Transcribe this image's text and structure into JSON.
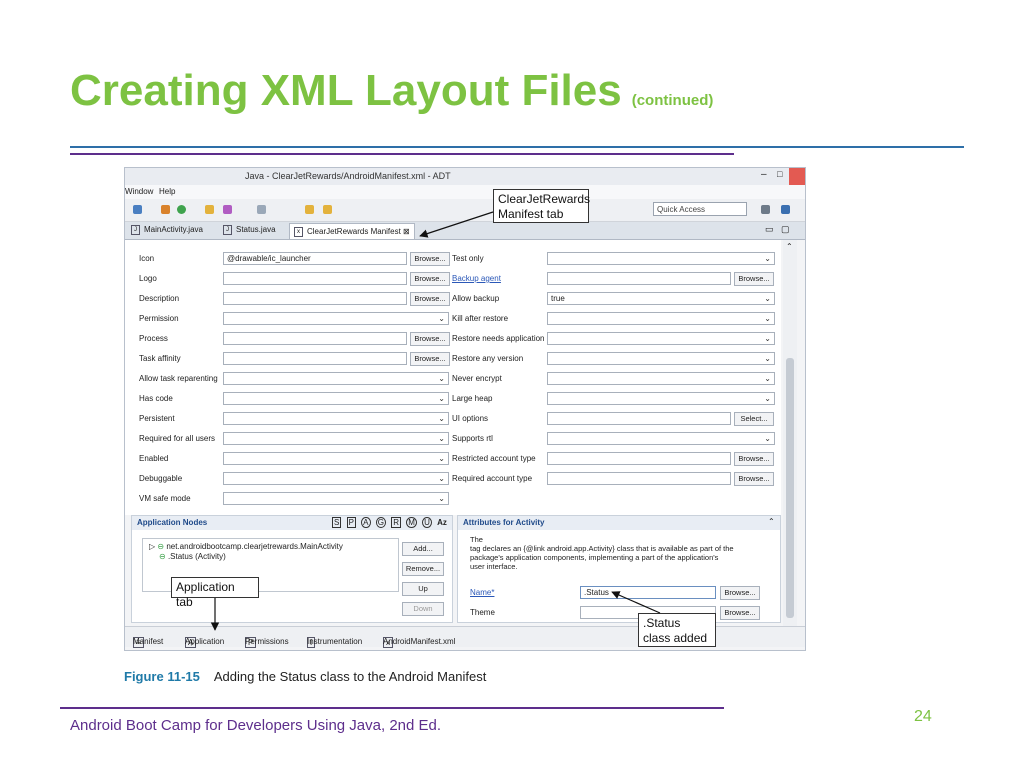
{
  "slide": {
    "title": "Creating XML Layout Files",
    "title_suffix": "(continued)",
    "footer": "Android Boot Camp for Developers Using Java, 2nd Ed.",
    "page_number": "24",
    "colors": {
      "title": "#7dc242",
      "rule_blue": "#2e6fa8",
      "rule_purple": "#5d2e8c"
    }
  },
  "window": {
    "title": "Java - ClearJetRewards/AndroidManifest.xml - ADT",
    "menu": [
      "Window",
      "Help"
    ],
    "quick_access": "Quick Access"
  },
  "tabs": [
    {
      "label": "MainActivity.java",
      "active": false
    },
    {
      "label": "Status.java",
      "active": false
    },
    {
      "label": "ClearJetRewards Manifest",
      "active": true
    }
  ],
  "left_fields": [
    {
      "label": "Icon",
      "value": "@drawable/ic_launcher",
      "control": "browse"
    },
    {
      "label": "Logo",
      "value": "",
      "control": "browse"
    },
    {
      "label": "Description",
      "value": "",
      "control": "browse"
    },
    {
      "label": "Permission",
      "value": "",
      "control": "dropdown"
    },
    {
      "label": "Process",
      "value": "",
      "control": "browse"
    },
    {
      "label": "Task affinity",
      "value": "",
      "control": "browse"
    },
    {
      "label": "Allow task reparenting",
      "value": "",
      "control": "dropdown"
    },
    {
      "label": "Has code",
      "value": "",
      "control": "dropdown"
    },
    {
      "label": "Persistent",
      "value": "",
      "control": "dropdown"
    },
    {
      "label": "Required for all users",
      "value": "",
      "control": "dropdown"
    },
    {
      "label": "Enabled",
      "value": "",
      "control": "dropdown"
    },
    {
      "label": "Debuggable",
      "value": "",
      "control": "dropdown"
    },
    {
      "label": "VM safe mode",
      "value": "",
      "control": "dropdown"
    }
  ],
  "right_fields": [
    {
      "label": "Test only",
      "value": "",
      "control": "dropdown",
      "link": false
    },
    {
      "label": "Backup agent",
      "value": "",
      "control": "browse",
      "link": true
    },
    {
      "label": "Allow backup",
      "value": "true",
      "control": "dropdown",
      "link": false
    },
    {
      "label": "Kill after restore",
      "value": "",
      "control": "dropdown",
      "link": false
    },
    {
      "label": "Restore needs application",
      "value": "",
      "control": "dropdown",
      "link": false
    },
    {
      "label": "Restore any version",
      "value": "",
      "control": "dropdown",
      "link": false
    },
    {
      "label": "Never encrypt",
      "value": "",
      "control": "dropdown",
      "link": false
    },
    {
      "label": "Large heap",
      "value": "",
      "control": "dropdown",
      "link": false
    },
    {
      "label": "UI options",
      "value": "",
      "control": "select",
      "link": false
    },
    {
      "label": "Supports rtl",
      "value": "",
      "control": "dropdown",
      "link": false
    },
    {
      "label": "Restricted account type",
      "value": "",
      "control": "browse",
      "link": false
    },
    {
      "label": "Required account type",
      "value": "",
      "control": "browse",
      "link": false
    }
  ],
  "buttons": {
    "browse": "Browse...",
    "select": "Select..."
  },
  "app_nodes": {
    "title": "Application Nodes",
    "letters": [
      "S",
      "P",
      "A",
      "G",
      "R",
      "M",
      "U"
    ],
    "sort": "Az",
    "items": [
      "net.androidbootcamp.clearjetrewards.MainActivity",
      ".Status (Activity)"
    ],
    "actions": [
      "Add...",
      "Remove...",
      "Up",
      "Down"
    ]
  },
  "attributes": {
    "title": "Attributes for Activity",
    "desc_1": "The",
    "desc_2": "tag declares an {@link android.app.Activity} class that is available as part of the",
    "desc_3": "package's application components, implementing a part of the application's",
    "desc_4": "user interface.",
    "name_label": "Name*",
    "name_value": ".Status",
    "theme_label": "Theme"
  },
  "bottom_tabs": [
    "Manifest",
    "Application",
    "Permissions",
    "Instrumentation",
    "AndroidManifest.xml"
  ],
  "callouts": {
    "manifest_tab": "ClearJetRewards Manifest tab",
    "application_tab": "Application tab",
    "status_added": ".Status class added"
  },
  "figure": {
    "number": "Figure 11-15",
    "caption": "Adding the Status class to the Android Manifest"
  }
}
